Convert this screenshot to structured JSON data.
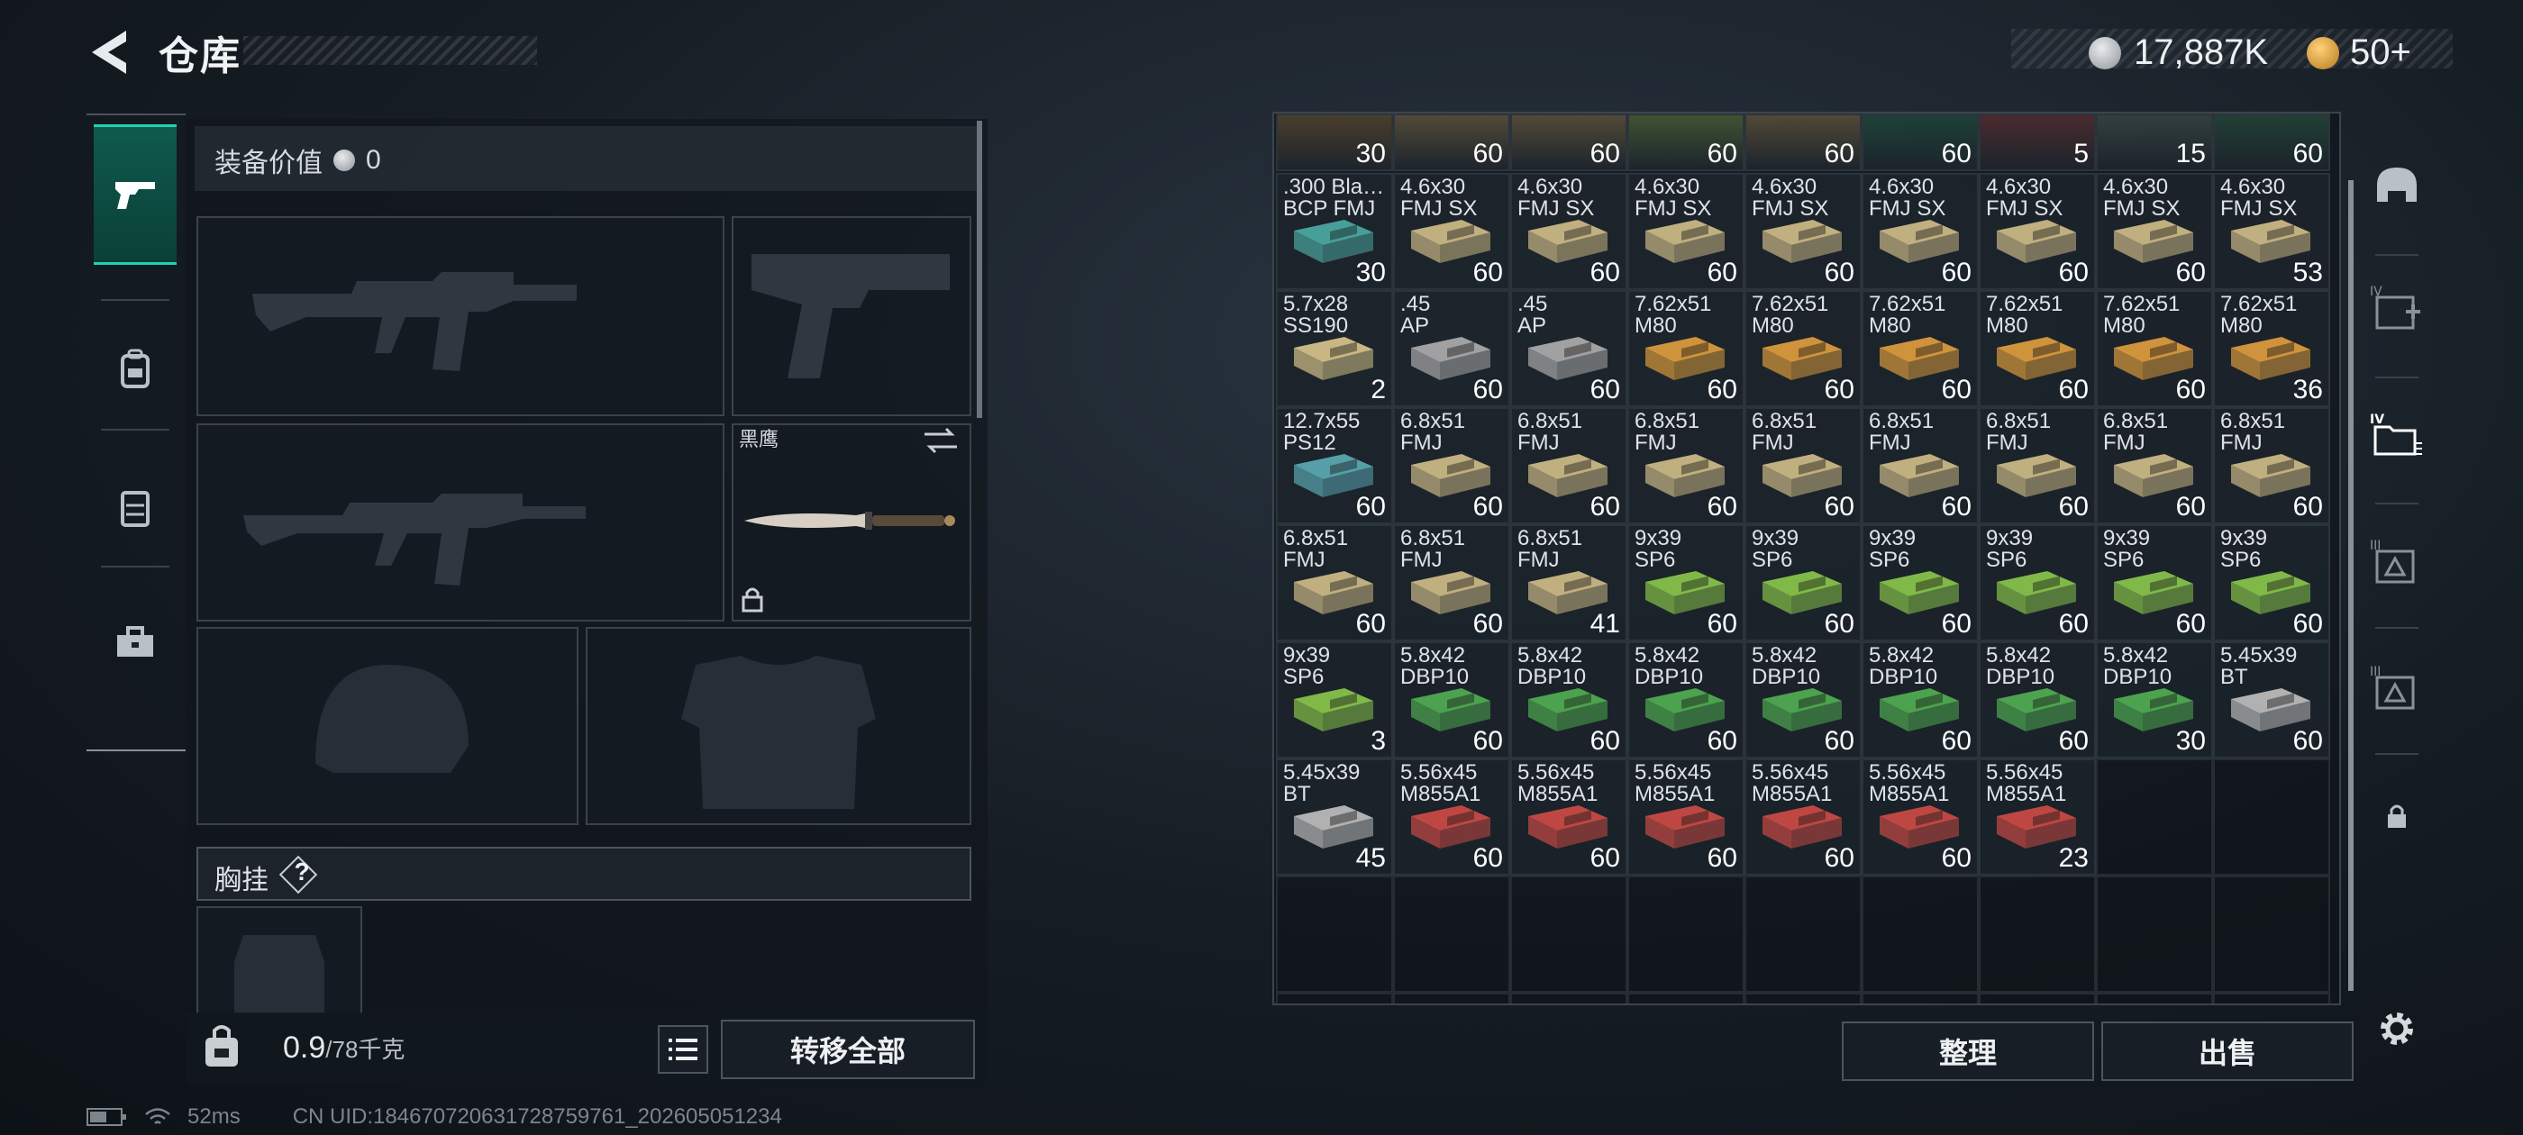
{
  "header": {
    "title": "仓库",
    "silver_amount": "17,887K",
    "gold_amount": "50+",
    "colors": {
      "silver": "#b7bcc1",
      "gold": "#e0a23a"
    }
  },
  "left_nav": [
    "pistol-icon",
    "backpack-icon",
    "vest-icon",
    "toolbox-icon"
  ],
  "loadout": {
    "value_label": "装备价值",
    "value_amount": "0",
    "knife_name": "黑鹰",
    "chest_label": "胸挂",
    "chest_help": "?"
  },
  "footer_left": {
    "weight_current": "0.9",
    "weight_max": "/78千克",
    "transfer_all": "转移全部"
  },
  "status": {
    "ping": "52ms",
    "uid": "CN UID:18467072063172875976​1_202605051234"
  },
  "grid": {
    "top_row": [
      {
        "qty": "30",
        "color": "#b0803c"
      },
      {
        "qty": "60",
        "color": "#c8a060"
      },
      {
        "qty": "60",
        "color": "#c8a060"
      },
      {
        "qty": "60",
        "color": "#8fbf4f"
      },
      {
        "qty": "60",
        "color": "#c8a060"
      },
      {
        "qty": "60",
        "color": "#2f8a62"
      },
      {
        "qty": "5",
        "color": "#b44848"
      },
      {
        "qty": "15",
        "color": "#6e8a7a"
      },
      {
        "qty": "60",
        "color": "#3e8a62"
      }
    ],
    "rows": [
      [
        {
          "name": ".300 Bla…\nBCP FMJ",
          "qty": "30",
          "color": "#4aa6a0"
        },
        {
          "name": "4.6x30\nFMJ SX",
          "qty": "60",
          "color": "#c9b784"
        },
        {
          "name": "4.6x30\nFMJ SX",
          "qty": "60",
          "color": "#c9b784"
        },
        {
          "name": "4.6x30\nFMJ SX",
          "qty": "60",
          "color": "#c9b784"
        },
        {
          "name": "4.6x30\nFMJ SX",
          "qty": "60",
          "color": "#c9b784"
        },
        {
          "name": "4.6x30\nFMJ SX",
          "qty": "60",
          "color": "#c9b784"
        },
        {
          "name": "4.6x30\nFMJ SX",
          "qty": "60",
          "color": "#c9b784"
        },
        {
          "name": "4.6x30\nFMJ SX",
          "qty": "60",
          "color": "#c9b784"
        },
        {
          "name": "4.6x30\nFMJ SX",
          "qty": "53",
          "color": "#c9b784"
        }
      ],
      [
        {
          "name": "5.7x28\nSS190",
          "qty": "2",
          "color": "#d2c089"
        },
        {
          "name": ".45\nAP",
          "qty": "60",
          "color": "#a9a9a9"
        },
        {
          "name": ".45\nAP",
          "qty": "60",
          "color": "#a9a9a9"
        },
        {
          "name": "7.62x51\nM80",
          "qty": "60",
          "color": "#d99a3c"
        },
        {
          "name": "7.62x51\nM80",
          "qty": "60",
          "color": "#d99a3c"
        },
        {
          "name": "7.62x51\nM80",
          "qty": "60",
          "color": "#d99a3c"
        },
        {
          "name": "7.62x51\nM80",
          "qty": "60",
          "color": "#d99a3c"
        },
        {
          "name": "7.62x51\nM80",
          "qty": "60",
          "color": "#d99a3c"
        },
        {
          "name": "7.62x51\nM80",
          "qty": "36",
          "color": "#d99a3c"
        }
      ],
      [
        {
          "name": "12.7x55\nPS12",
          "qty": "60",
          "color": "#5aa6b0"
        },
        {
          "name": "6.8x51\nFMJ",
          "qty": "60",
          "color": "#c9b784"
        },
        {
          "name": "6.8x51\nFMJ",
          "qty": "60",
          "color": "#c9b784"
        },
        {
          "name": "6.8x51\nFMJ",
          "qty": "60",
          "color": "#c9b784"
        },
        {
          "name": "6.8x51\nFMJ",
          "qty": "60",
          "color": "#c9b784"
        },
        {
          "name": "6.8x51\nFMJ",
          "qty": "60",
          "color": "#c9b784"
        },
        {
          "name": "6.8x51\nFMJ",
          "qty": "60",
          "color": "#c9b784"
        },
        {
          "name": "6.8x51\nFMJ",
          "qty": "60",
          "color": "#c9b784"
        },
        {
          "name": "6.8x51\nFMJ",
          "qty": "60",
          "color": "#c9b784"
        }
      ],
      [
        {
          "name": "6.8x51\nFMJ",
          "qty": "60",
          "color": "#c9b784"
        },
        {
          "name": "6.8x51\nFMJ",
          "qty": "60",
          "color": "#c9b784"
        },
        {
          "name": "6.8x51\nFMJ",
          "qty": "41",
          "color": "#c9b784"
        },
        {
          "name": "9x39\nSP6",
          "qty": "60",
          "color": "#86c24a"
        },
        {
          "name": "9x39\nSP6",
          "qty": "60",
          "color": "#86c24a"
        },
        {
          "name": "9x39\nSP6",
          "qty": "60",
          "color": "#86c24a"
        },
        {
          "name": "9x39\nSP6",
          "qty": "60",
          "color": "#86c24a"
        },
        {
          "name": "9x39\nSP6",
          "qty": "60",
          "color": "#86c24a"
        },
        {
          "name": "9x39\nSP6",
          "qty": "60",
          "color": "#86c24a"
        }
      ],
      [
        {
          "name": "9x39\nSP6",
          "qty": "3",
          "color": "#86c24a"
        },
        {
          "name": "5.8x42\nDBP10",
          "qty": "60",
          "color": "#4faa50"
        },
        {
          "name": "5.8x42\nDBP10",
          "qty": "60",
          "color": "#4faa50"
        },
        {
          "name": "5.8x42\nDBP10",
          "qty": "60",
          "color": "#4faa50"
        },
        {
          "name": "5.8x42\nDBP10",
          "qty": "60",
          "color": "#4faa50"
        },
        {
          "name": "5.8x42\nDBP10",
          "qty": "60",
          "color": "#4faa50"
        },
        {
          "name": "5.8x42\nDBP10",
          "qty": "60",
          "color": "#4faa50"
        },
        {
          "name": "5.8x42\nDBP10",
          "qty": "30",
          "color": "#4faa50"
        },
        {
          "name": "5.45x39\nBT",
          "qty": "60",
          "color": "#b9b9b9"
        }
      ],
      [
        {
          "name": "5.45x39\nBT",
          "qty": "45",
          "color": "#b9b9b9"
        },
        {
          "name": "5.56x45\nM855A1",
          "qty": "60",
          "color": "#c84a44"
        },
        {
          "name": "5.56x45\nM855A1",
          "qty": "60",
          "color": "#c84a44"
        },
        {
          "name": "5.56x45\nM855A1",
          "qty": "60",
          "color": "#c84a44"
        },
        {
          "name": "5.56x45\nM855A1",
          "qty": "60",
          "color": "#c84a44"
        },
        {
          "name": "5.56x45\nM855A1",
          "qty": "60",
          "color": "#c84a44"
        },
        {
          "name": "5.56x45\nM855A1",
          "qty": "23",
          "color": "#c84a44"
        }
      ]
    ]
  },
  "actions": {
    "sort": "整理",
    "sell": "出售"
  },
  "right_nav": [
    "helmet-icon",
    "add-storage-icon",
    "folder-storage-icon",
    "triangle-storage-icon",
    "triangle-storage-2-icon",
    "lock-icon",
    "settings-icon"
  ]
}
